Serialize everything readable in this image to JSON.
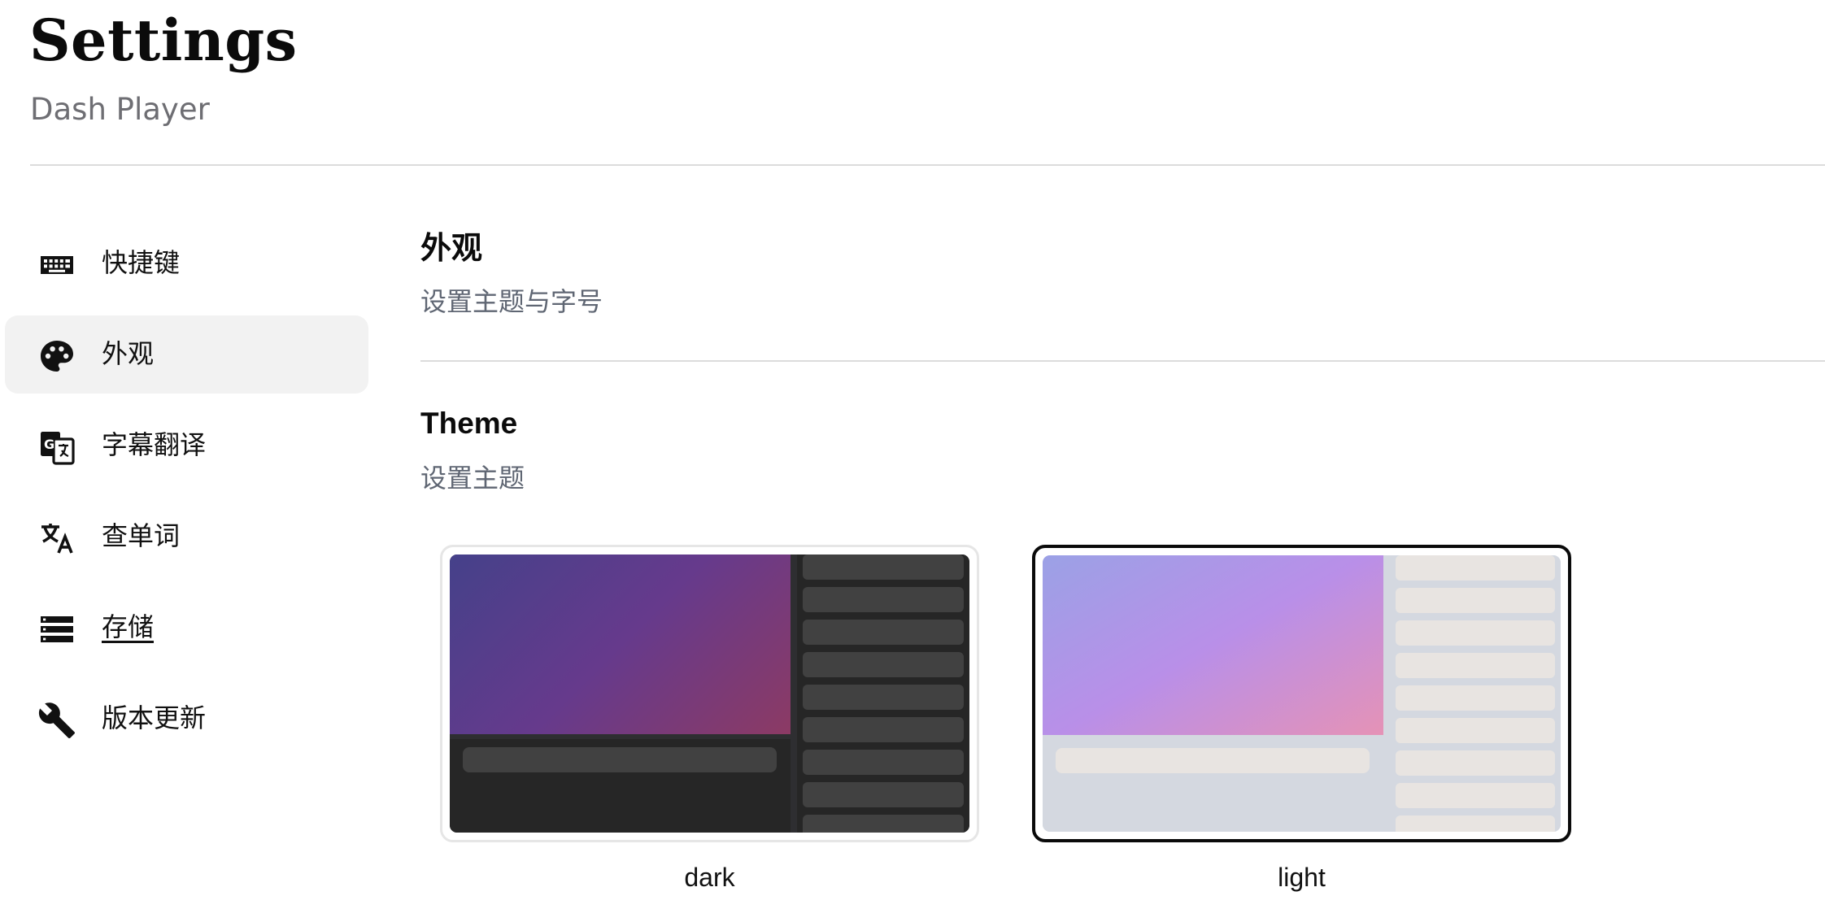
{
  "header": {
    "title": "Settings",
    "app_name": "Dash Player"
  },
  "sidebar": {
    "items": [
      {
        "label": "快捷键",
        "icon": "keyboard-icon",
        "active": false
      },
      {
        "label": "外观",
        "icon": "palette-icon",
        "active": true
      },
      {
        "label": "字幕翻译",
        "icon": "translate-icon",
        "active": false
      },
      {
        "label": "查单词",
        "icon": "language-icon",
        "active": false
      },
      {
        "label": "存储",
        "icon": "storage-icon",
        "active": false
      },
      {
        "label": "版本更新",
        "icon": "wrench-icon",
        "active": false
      }
    ]
  },
  "main": {
    "section_title": "外观",
    "section_subtitle": "设置主题与字号",
    "theme": {
      "heading": "Theme",
      "subtitle": "设置主题",
      "options": [
        {
          "label": "dark",
          "selected": false
        },
        {
          "label": "light",
          "selected": true
        }
      ]
    }
  },
  "colors": {
    "active_item_bg": "#f2f2f2",
    "subtitle_gray": "#5f6673",
    "selected_border": "#0a0a0a"
  }
}
